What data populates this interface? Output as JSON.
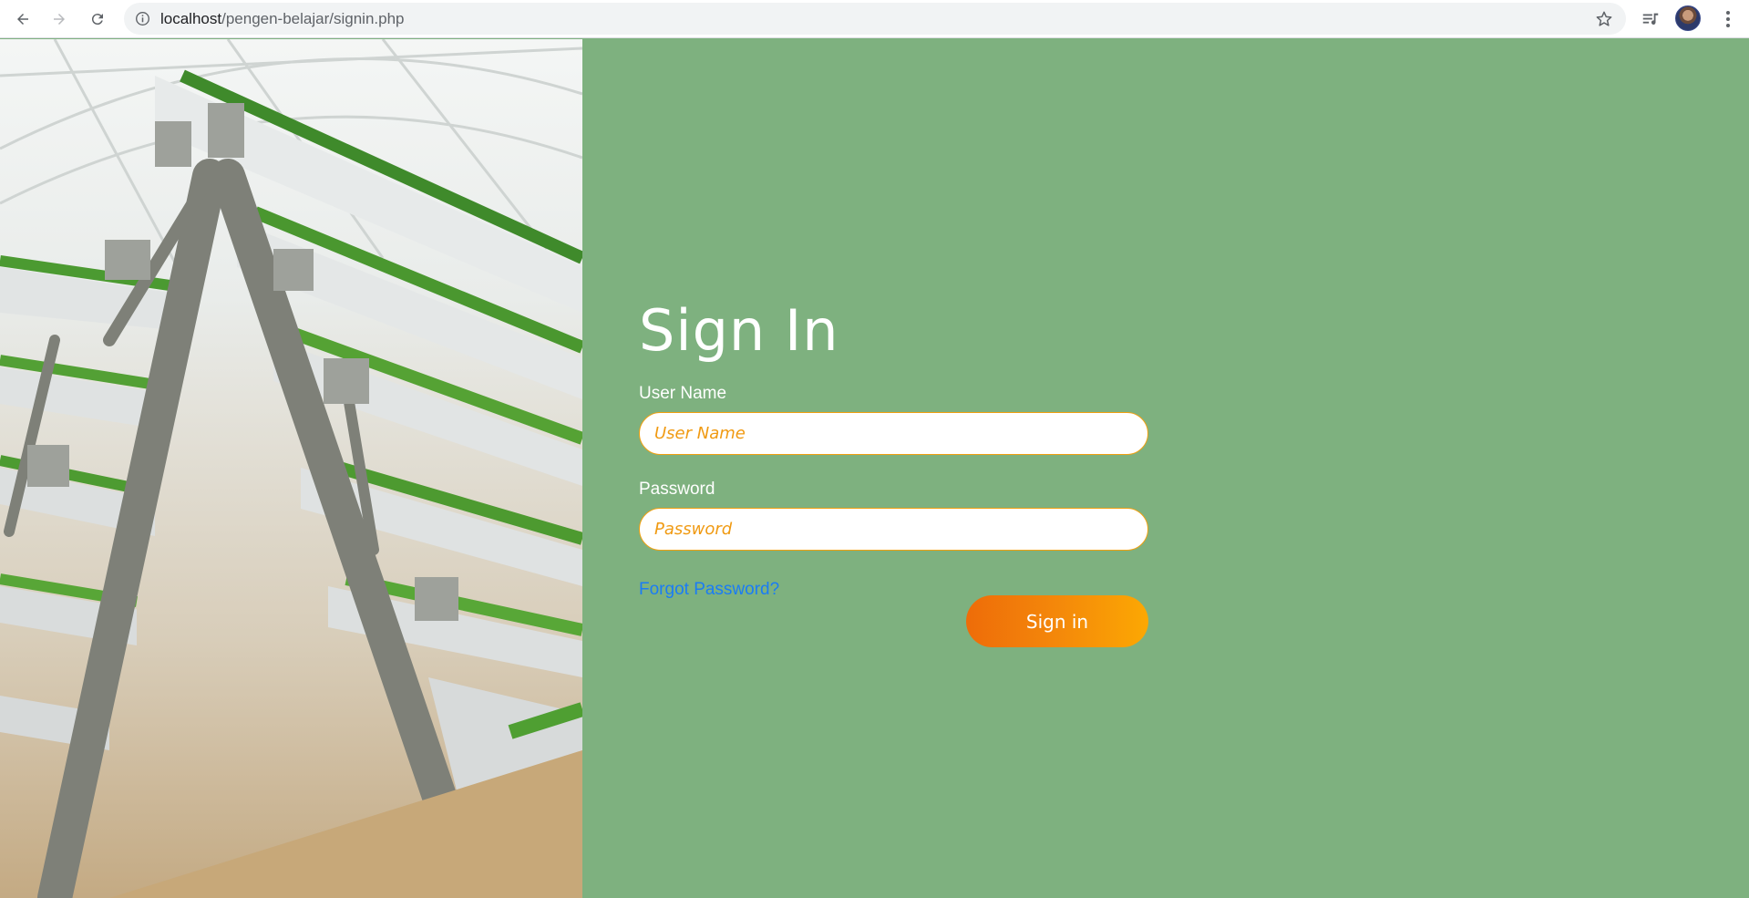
{
  "browser": {
    "url_host": "localhost",
    "url_path": "/pengen-belajar/signin.php",
    "icons": [
      "back-arrow-icon",
      "forward-arrow-icon",
      "reload-icon",
      "info-icon",
      "star-icon",
      "media-queue-icon",
      "profile-avatar",
      "more-vert-icon"
    ]
  },
  "signin": {
    "title": "Sign In",
    "username_label": "User Name",
    "username_placeholder": "User Name",
    "password_label": "Password",
    "password_placeholder": "Password",
    "forgot_label": "Forgot Password?",
    "submit_label": "Sign in"
  },
  "colors": {
    "background": "#7eb17f",
    "input_border": "#f0a010",
    "placeholder": "#f09a12",
    "link": "#1a7cf5",
    "button_gradient": [
      "#ee6c09",
      "#fca803"
    ]
  }
}
